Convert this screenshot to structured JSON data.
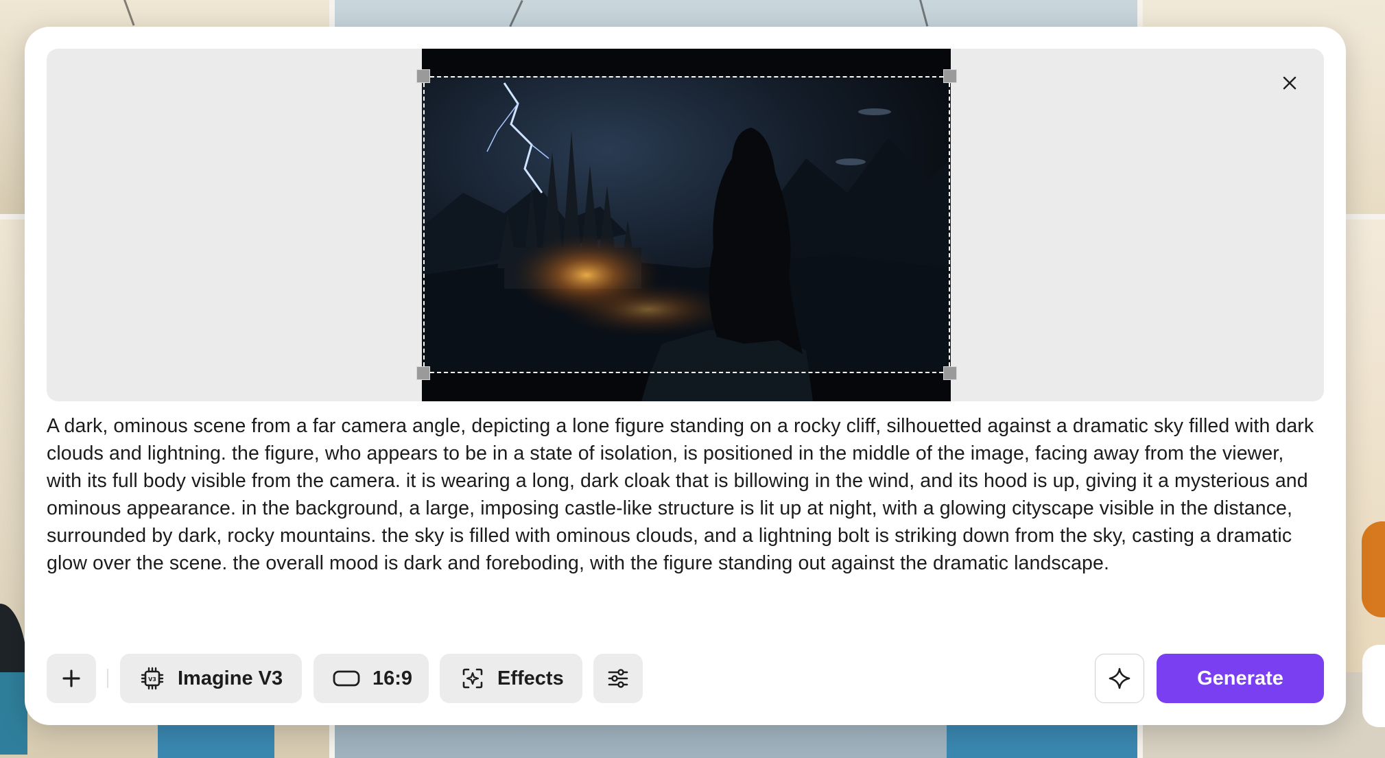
{
  "modal": {
    "close_icon": "close-icon",
    "prompt_text": "A dark, ominous scene from a far camera angle, depicting a lone figure standing on a rocky cliff, silhouetted against a dramatic sky filled with dark clouds and lightning. the figure, who appears to be in a state of isolation, is positioned in the middle of the image, facing away from the viewer, with its full body visible from the camera. it is wearing a long, dark cloak that is billowing in the wind, and its hood is up, giving it a mysterious and ominous appearance. in the background, a large, imposing castle-like structure is lit up at night, with a glowing cityscape visible in the distance, surrounded by dark, rocky mountains. the sky is filled with ominous clouds, and a lightning bolt is striking down from the sky, casting a dramatic glow over the scene. the overall mood is dark and foreboding, with the figure standing out against the dramatic landscape."
  },
  "toolbar": {
    "add_icon": "plus-icon",
    "model_label": "Imagine V3",
    "model_icon": "chip-icon",
    "ratio_label": "16:9",
    "ratio_icon": "aspect-ratio-icon",
    "effects_label": "Effects",
    "effects_icon": "effects-icon",
    "settings_icon": "sliders-icon",
    "enhance_icon": "sparkle-icon",
    "generate_label": "Generate"
  },
  "colors": {
    "accent": "#7b3ff2",
    "button_bg": "#ececec",
    "preview_bg": "#ebebeb"
  }
}
